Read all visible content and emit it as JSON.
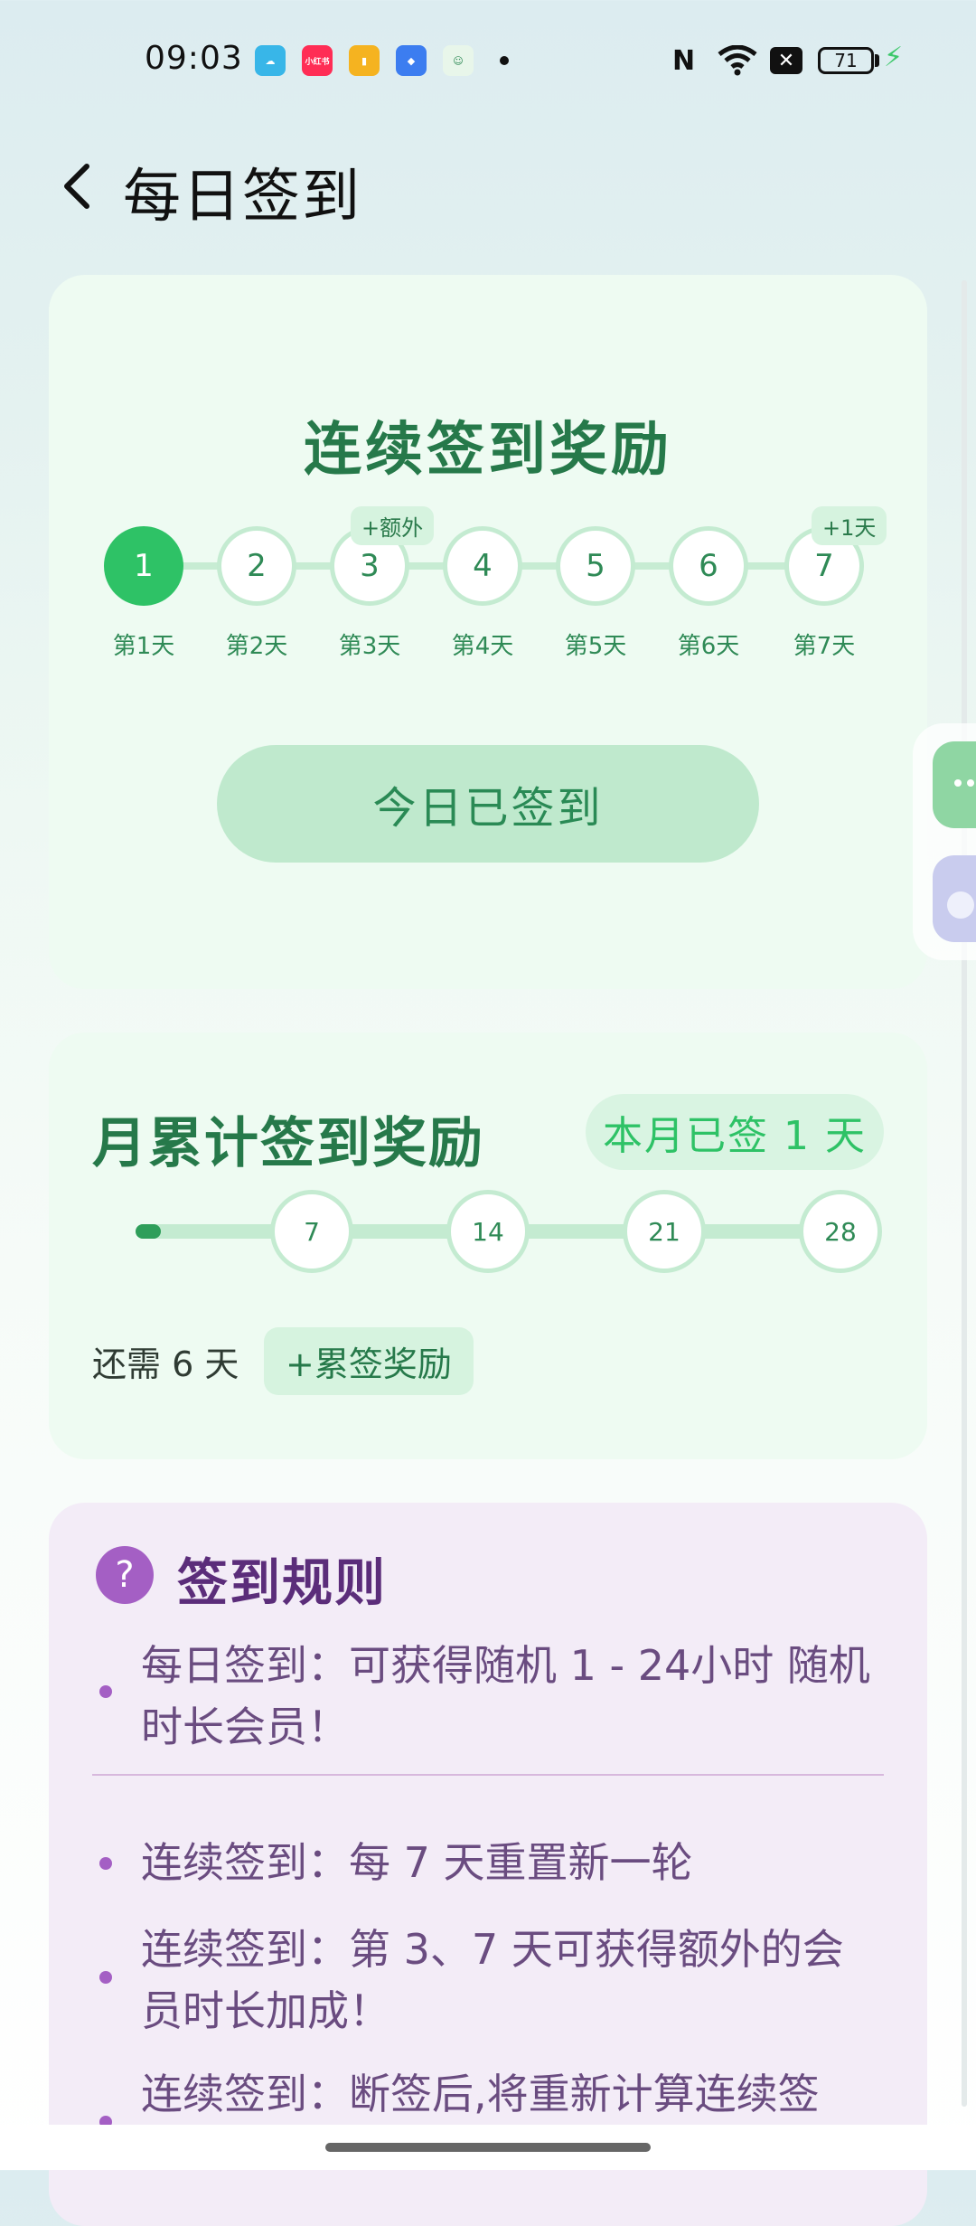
{
  "status_bar": {
    "time": "09:03",
    "apps": [
      {
        "name": "cloud-app-icon",
        "color": "#38b6e8",
        "text": ""
      },
      {
        "name": "xiaohongshu-app-icon",
        "color": "#ff2d55",
        "text": "小红书"
      },
      {
        "name": "book-app-icon",
        "color": "#f5b320",
        "text": ""
      },
      {
        "name": "blue-app-icon",
        "color": "#3c7df0",
        "text": ""
      },
      {
        "name": "green-face-app-icon",
        "color": "#3cb371",
        "text": ""
      }
    ],
    "battery": "71"
  },
  "header": {
    "title": "每日签到"
  },
  "streak": {
    "title": "连续签到奖励",
    "days": [
      {
        "num": "1",
        "label": "第1天",
        "active": true
      },
      {
        "num": "2",
        "label": "第2天",
        "active": false
      },
      {
        "num": "3",
        "label": "第3天",
        "active": false,
        "badge": "+额外"
      },
      {
        "num": "4",
        "label": "第4天",
        "active": false
      },
      {
        "num": "5",
        "label": "第5天",
        "active": false
      },
      {
        "num": "6",
        "label": "第6天",
        "active": false
      },
      {
        "num": "7",
        "label": "第7天",
        "active": false,
        "badge": "+1天"
      }
    ],
    "button_label": "今日已签到"
  },
  "monthly": {
    "title": "月累计签到奖励",
    "signed_pill": "本月已签 1 天",
    "milestones": [
      "7",
      "14",
      "21",
      "28"
    ],
    "progress_days": 1,
    "need_text": "还需 6 天",
    "bonus_chip": "+累签奖励"
  },
  "rules": {
    "title": "签到规则",
    "icon_text": "?",
    "items": [
      {
        "line1": "每日签到：可获得随机 1 - 24小时 随机",
        "line2": "时长会员！"
      },
      {
        "line1": "连续签到：每 7 天重置新一轮",
        "line2": ""
      },
      {
        "line1": "连续签到：第 3、7 天可获得额外的会",
        "line2": "员时长加成！"
      },
      {
        "line1": "连续签到：断签后,将重新计算连续签",
        "line2": ""
      }
    ]
  }
}
